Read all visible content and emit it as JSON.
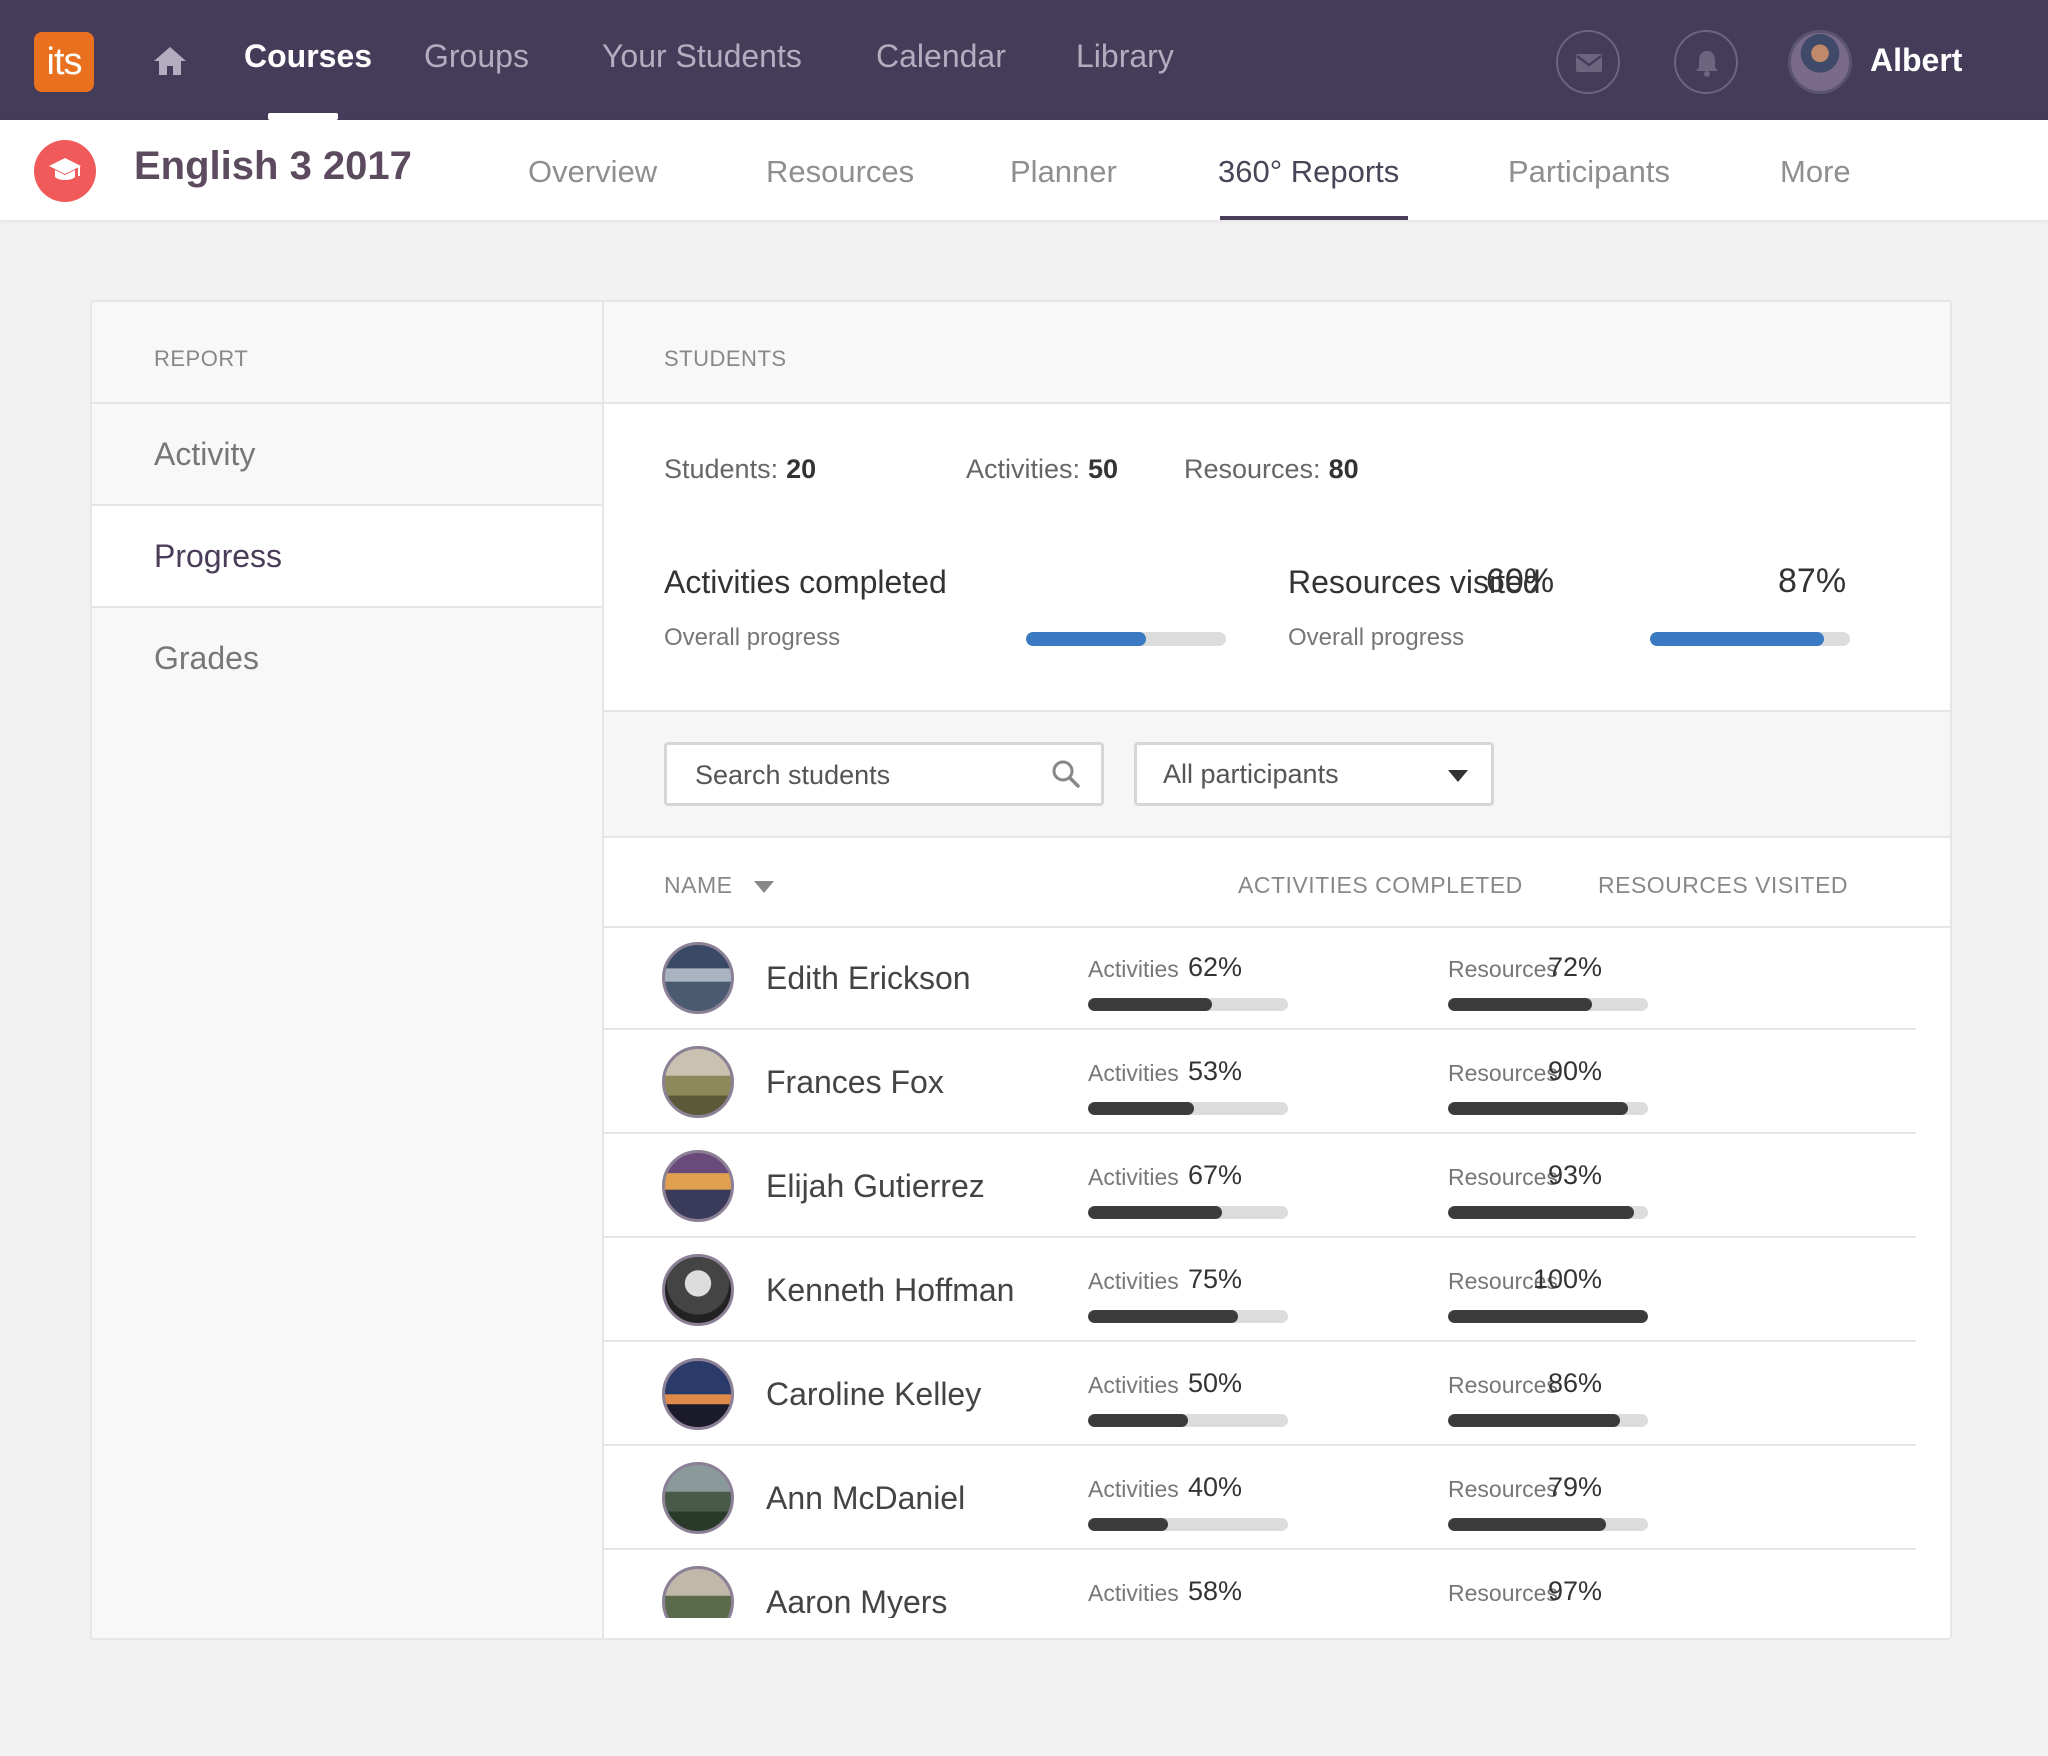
{
  "app": {
    "logo_text": "its",
    "user_name": "Albert"
  },
  "topnav": [
    {
      "label": "Courses",
      "active": true
    },
    {
      "label": "Groups"
    },
    {
      "label": "Your Students"
    },
    {
      "label": "Calendar"
    },
    {
      "label": "Library"
    }
  ],
  "icons": {
    "home": "home-icon",
    "mail": "mail-icon",
    "bell": "bell-icon",
    "course": "graduation-cap-icon",
    "search": "search-icon",
    "dropdown": "caret-down-icon"
  },
  "course": {
    "title": "English 3 2017"
  },
  "subnav": [
    {
      "label": "Overview"
    },
    {
      "label": "Resources"
    },
    {
      "label": "Planner"
    },
    {
      "label": "360° Reports",
      "active": true
    },
    {
      "label": "Participants"
    },
    {
      "label": "More"
    }
  ],
  "sidebar": {
    "heading": "REPORT",
    "items": [
      {
        "label": "Activity"
      },
      {
        "label": "Progress",
        "active": true
      },
      {
        "label": "Grades"
      }
    ]
  },
  "main": {
    "heading": "STUDENTS",
    "stats": [
      {
        "label": "Students:",
        "value": "20"
      },
      {
        "label": "Activities:",
        "value": "50"
      },
      {
        "label": "Resources:",
        "value": "80"
      }
    ],
    "summary": [
      {
        "title": "Activities completed",
        "pct_text": "60%",
        "pct": 0.6,
        "sub": "Overall progress"
      },
      {
        "title": "Resources visited",
        "pct_text": "87%",
        "pct": 0.87,
        "sub": "Overall progress"
      }
    ],
    "search_placeholder": "Search students",
    "filter_value": "All participants",
    "columns": {
      "name": "NAME",
      "activities": "ACTIVITIES COMPLETED",
      "resources": "RESOURCES VISITED"
    },
    "activities_label": "Activities",
    "resources_label": "Resources",
    "students": [
      {
        "name": "Edith Erickson",
        "act_text": "62%",
        "act": 0.62,
        "res_text": "72%",
        "res": 0.72
      },
      {
        "name": "Frances Fox",
        "act_text": "53%",
        "act": 0.53,
        "res_text": "90%",
        "res": 0.9
      },
      {
        "name": "Elijah Gutierrez",
        "act_text": "67%",
        "act": 0.67,
        "res_text": "93%",
        "res": 0.93
      },
      {
        "name": "Kenneth Hoffman",
        "act_text": "75%",
        "act": 0.75,
        "res_text": "100%",
        "res": 1.0
      },
      {
        "name": "Caroline Kelley",
        "act_text": "50%",
        "act": 0.5,
        "res_text": "86%",
        "res": 0.86
      },
      {
        "name": "Ann McDaniel",
        "act_text": "40%",
        "act": 0.4,
        "res_text": "79%",
        "res": 0.79
      },
      {
        "name": "Aaron Myers",
        "act_text": "58%",
        "act": 0.58,
        "res_text": "97%",
        "res": 0.97
      }
    ]
  },
  "colors": {
    "nav_bg": "#443c58",
    "logo": "#e8701f",
    "course_icon": "#f15a5a",
    "bar_blue": "#3a7ac2",
    "bar_dark": "#3c3c3c"
  }
}
